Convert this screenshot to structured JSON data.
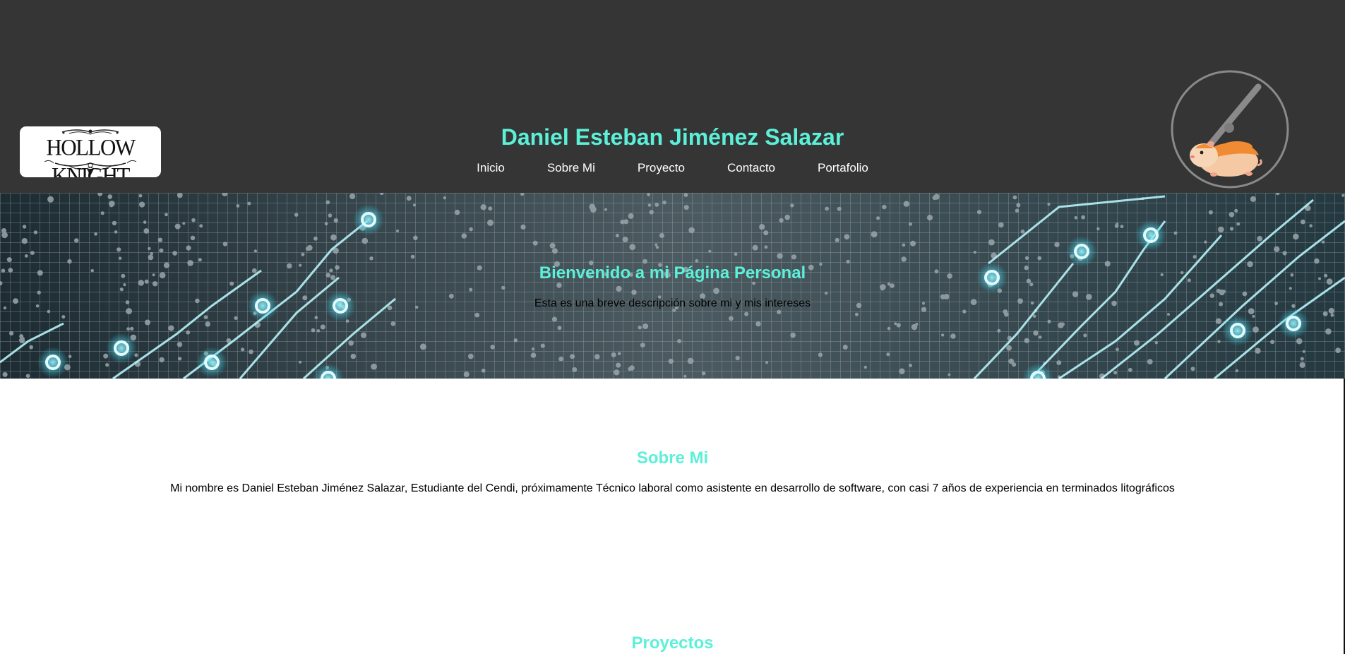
{
  "header": {
    "logo_text": "HOLLOW KNIGHT",
    "title": "Daniel Esteban Jiménez Salazar",
    "nav": [
      {
        "label": "Inicio"
      },
      {
        "label": "Sobre Mi"
      },
      {
        "label": "Proyecto"
      },
      {
        "label": "Contacto"
      },
      {
        "label": "Portafolio"
      }
    ],
    "avatar_icon": "hamster-wheel-icon"
  },
  "hero": {
    "title": "Bienvenido a mi Página Personal",
    "text": "Esta es una breve descripción sobre mi y mis intereses",
    "background_icon": "circuit-board-image"
  },
  "about": {
    "title": "Sobre Mi",
    "text": "Mi nombre es Daniel Esteban Jiménez Salazar, Estudiante del Cendi, próximamente Técnico laboral como asistente en desarrollo de software, con casi 7 años de experiencia en terminados litográficos"
  },
  "projects": {
    "title": "Proyectos"
  },
  "colors": {
    "header_bg": "#353535",
    "accent": "#5cf0d8",
    "nav_text": "#ffffff",
    "body_text": "#000000"
  }
}
